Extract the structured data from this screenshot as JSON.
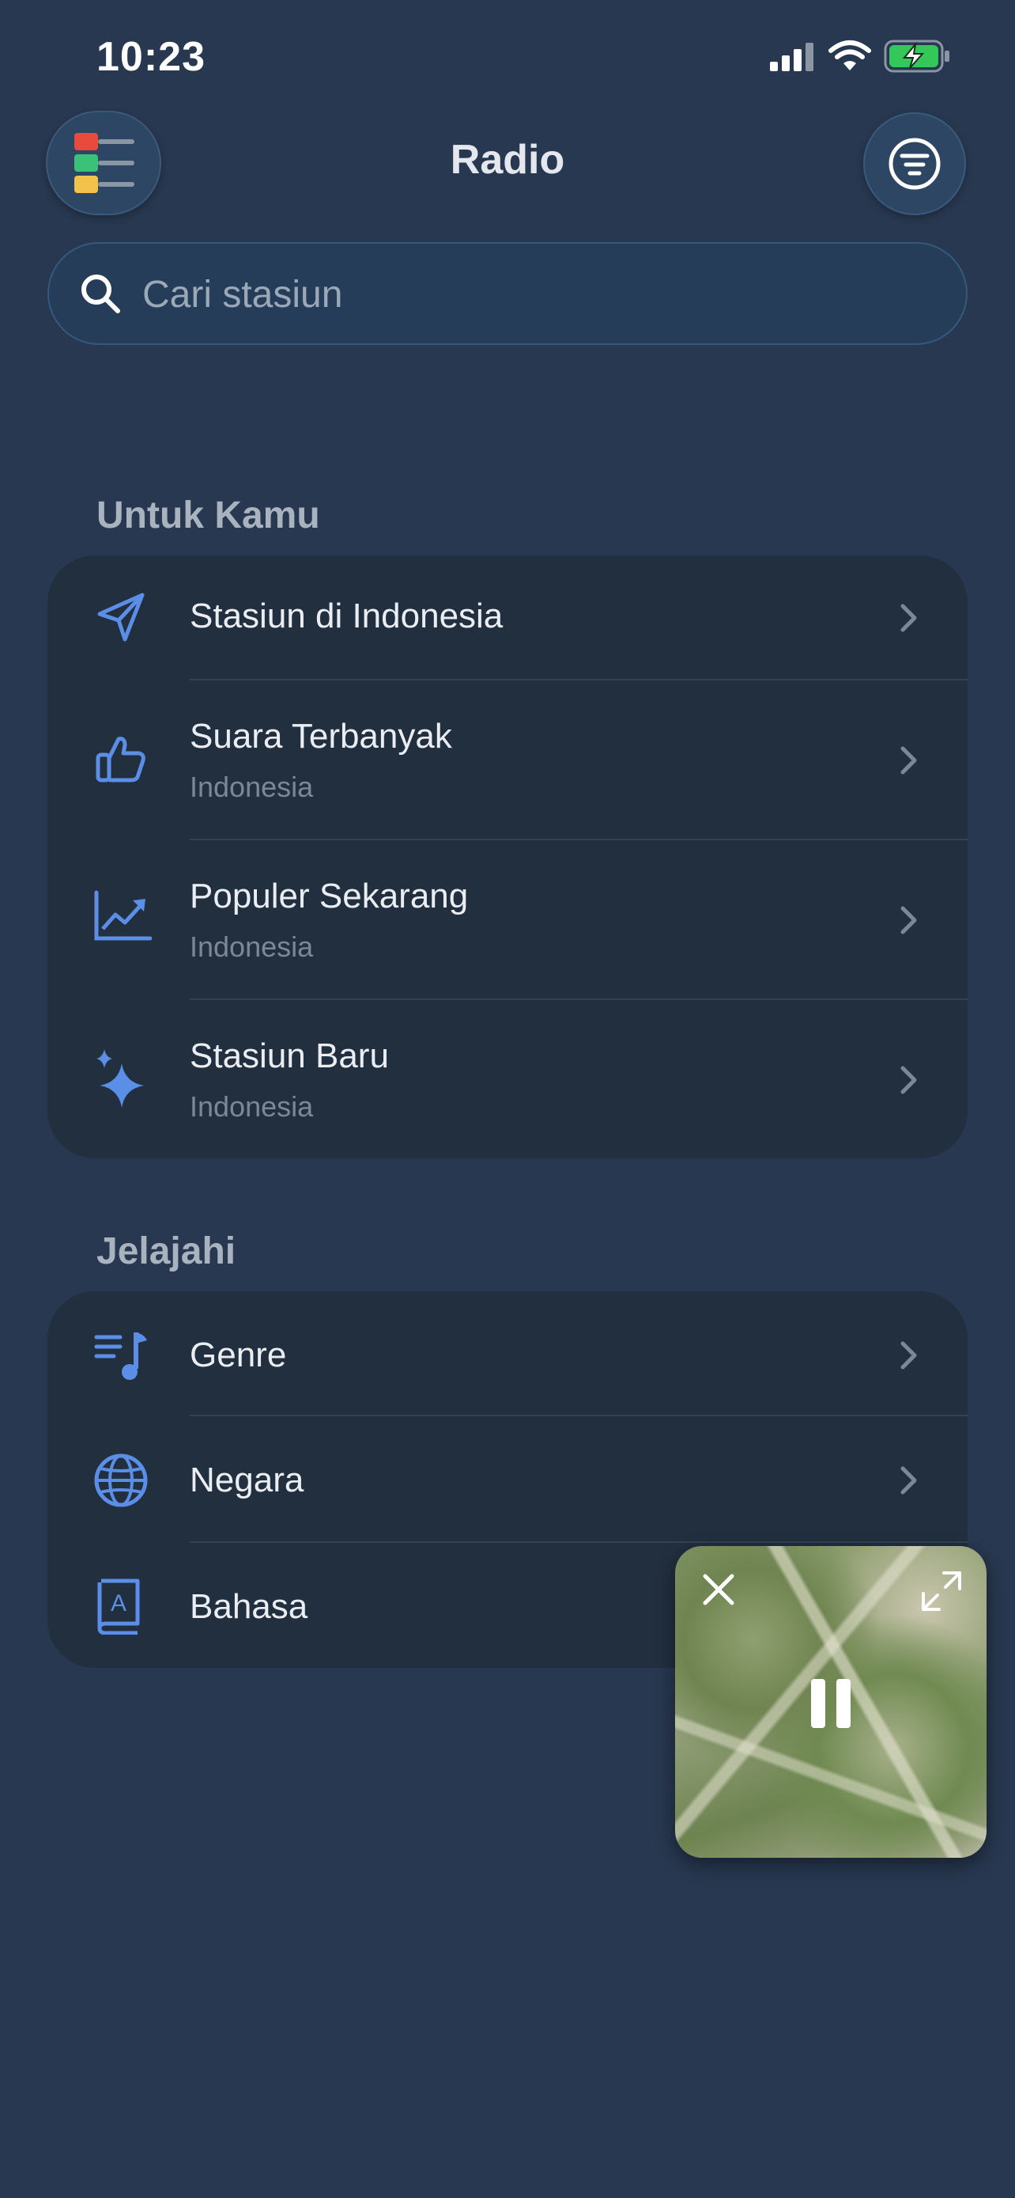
{
  "status_bar": {
    "time": "10:23"
  },
  "header": {
    "title": "Radio"
  },
  "search": {
    "placeholder": "Cari stasiun"
  },
  "sections": {
    "for_you": {
      "title": "Untuk Kamu",
      "items": [
        {
          "icon": "location-arrow-icon",
          "label": "Stasiun di Indonesia",
          "sub": ""
        },
        {
          "icon": "thumbs-up-icon",
          "label": "Suara Terbanyak",
          "sub": "Indonesia"
        },
        {
          "icon": "trending-chart-icon",
          "label": "Populer Sekarang",
          "sub": "Indonesia"
        },
        {
          "icon": "sparkles-icon",
          "label": "Stasiun Baru",
          "sub": "Indonesia"
        }
      ]
    },
    "explore": {
      "title": "Jelajahi",
      "items": [
        {
          "icon": "music-list-icon",
          "label": "Genre"
        },
        {
          "icon": "globe-icon",
          "label": "Negara"
        },
        {
          "icon": "book-icon",
          "label": "Bahasa"
        }
      ]
    }
  },
  "colors": {
    "accent": "#5b8ee6",
    "background": "#283850",
    "card": "#222f3f"
  }
}
